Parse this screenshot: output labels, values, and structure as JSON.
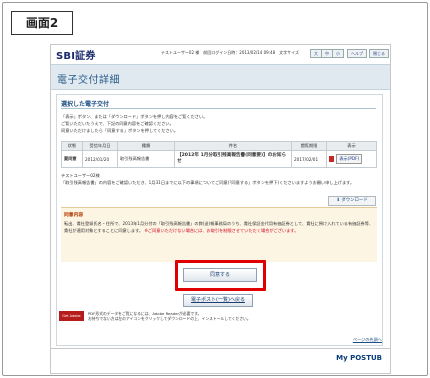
{
  "screen_label": "画面2",
  "header": {
    "logo": "SBI証券",
    "user_info": "テストユーザー02 様　前回ログイン日時：2013/02/14 09:48　文字サイズ",
    "size_large": "大",
    "size_medium": "中",
    "size_small": "小",
    "help": "ヘルプ",
    "close": "閉じる"
  },
  "page_title": "電子交付詳細",
  "section": {
    "title": "選択した電子交付",
    "instructions": [
      "「表示」ボタン、または「ダウンロード」ボタンを押し内容をご覧ください。",
      "ご覧いただいたうえで、下記の同意内容をご確認ください。",
      "同意いただけましたら「同意する」ボタンを押してください。"
    ],
    "table": {
      "headers": [
        "状態",
        "受信年月日",
        "種類",
        "件名",
        "閲覧期限",
        "表示"
      ],
      "row": {
        "status": "要同意",
        "received": "2012/01/20",
        "type": "取引残高報告書",
        "subject": "【2012年 1月分取引残高報告書(同意要)】のお知らせ",
        "deadline": "2017/02/01",
        "view": "表示(PDF)"
      }
    },
    "message": "テストユーザー02様\n「取引残高報告書」の内容をご確認いただき、1月31日までに以下の事項についてご同意(「同意する」ボタンを押下)くださいますようお願い申し上げます。",
    "download": "ダウンロード",
    "agreement": {
      "title": "同意内容",
      "text": "転出、貴社登録氏名・住所で、2013年1月分付の「取引残高報告書」の弊(送)報事務局のうち、貴社保証金代用有価証券として、貴社に預け入れている有価証券等、貴社が適用対象とすることに同意します。",
      "note": "※ご同意いただけない場合には、お取引を制限させていただく場合がございます。"
    },
    "consent_button": "同意する",
    "post_button": "電子ポスト(一覧)へ戻る",
    "adobe_text": "PDF形式のデータをご覧になるには、Adobe Readerが必要です。\n お持ちでない方は左のアイコンをクリックしてダウンロードの上、インストールしてください。",
    "adobe_badge": "Get Adobe Reader",
    "top_link": "ページの先頭へ"
  },
  "footer": {
    "brand": "My POSTUB"
  }
}
